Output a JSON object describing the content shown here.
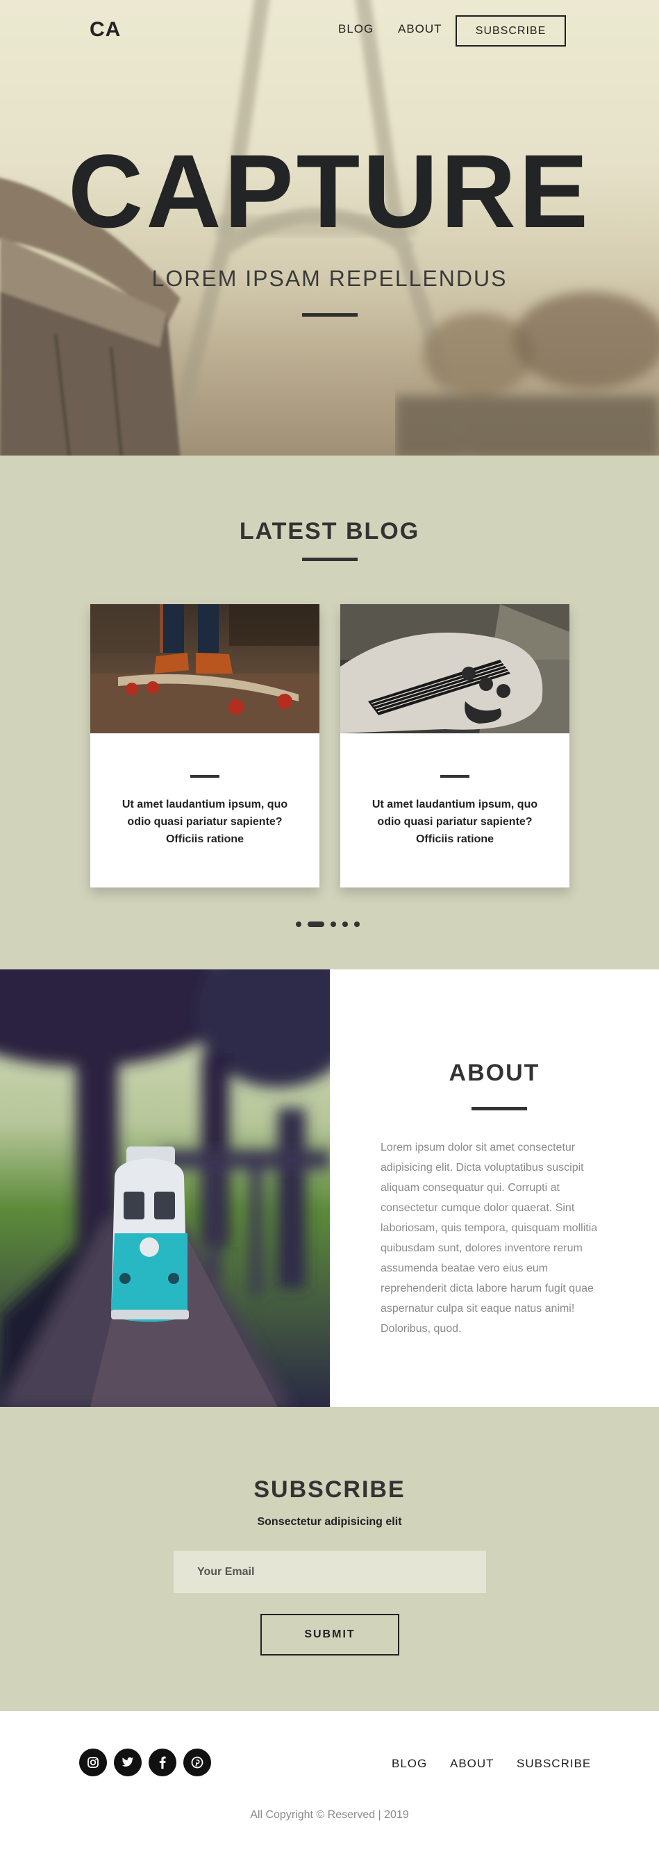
{
  "nav": {
    "logo": "CA",
    "links": [
      "BLOG",
      "ABOUT"
    ],
    "subscribe": "SUBSCRIBE"
  },
  "hero": {
    "title": "CAPTURE",
    "subtitle": "LOREM IPSAM REPELLENDUS"
  },
  "blog": {
    "title": "LATEST BLOG",
    "cards": [
      {
        "text": "Ut amet laudantium ipsum, quo odio quasi pariatur sapiente? Officiis ratione"
      },
      {
        "text": "Ut amet laudantium ipsum, quo odio quasi pariatur sapiente? Officiis ratione"
      }
    ],
    "carousel": {
      "total_dots": 5,
      "active_index": 1
    }
  },
  "about": {
    "title": "ABOUT",
    "body": "Lorem ipsum dolor sit amet consectetur adipisicing elit. Dicta voluptatibus suscipit aliquam consequatur qui. Corrupti at consectetur cumque dolor quaerat. Sint laboriosam, quis tempora, quisquam mollitia quibusdam sunt, dolores inventore rerum assumenda beatae vero eius eum reprehenderit dicta labore harum fugit quae aspernatur culpa sit eaque natus animi! Doloribus, quod."
  },
  "subscribe": {
    "title": "SUBSCRIBE",
    "subtitle": "Sonsectetur adipisicing elit",
    "email_placeholder": "Your Email",
    "submit": "SUBMIT"
  },
  "footer": {
    "social": [
      "instagram-icon",
      "twitter-icon",
      "facebook-icon",
      "pinterest-icon"
    ],
    "links": [
      "BLOG",
      "ABOUT",
      "SUBSCRIBE"
    ],
    "copyright": "All Copyright © Reserved | 2019"
  },
  "colors": {
    "section_bg": "#d1d3bb",
    "text_dark": "#222222",
    "text_muted": "#8a8a8a"
  }
}
